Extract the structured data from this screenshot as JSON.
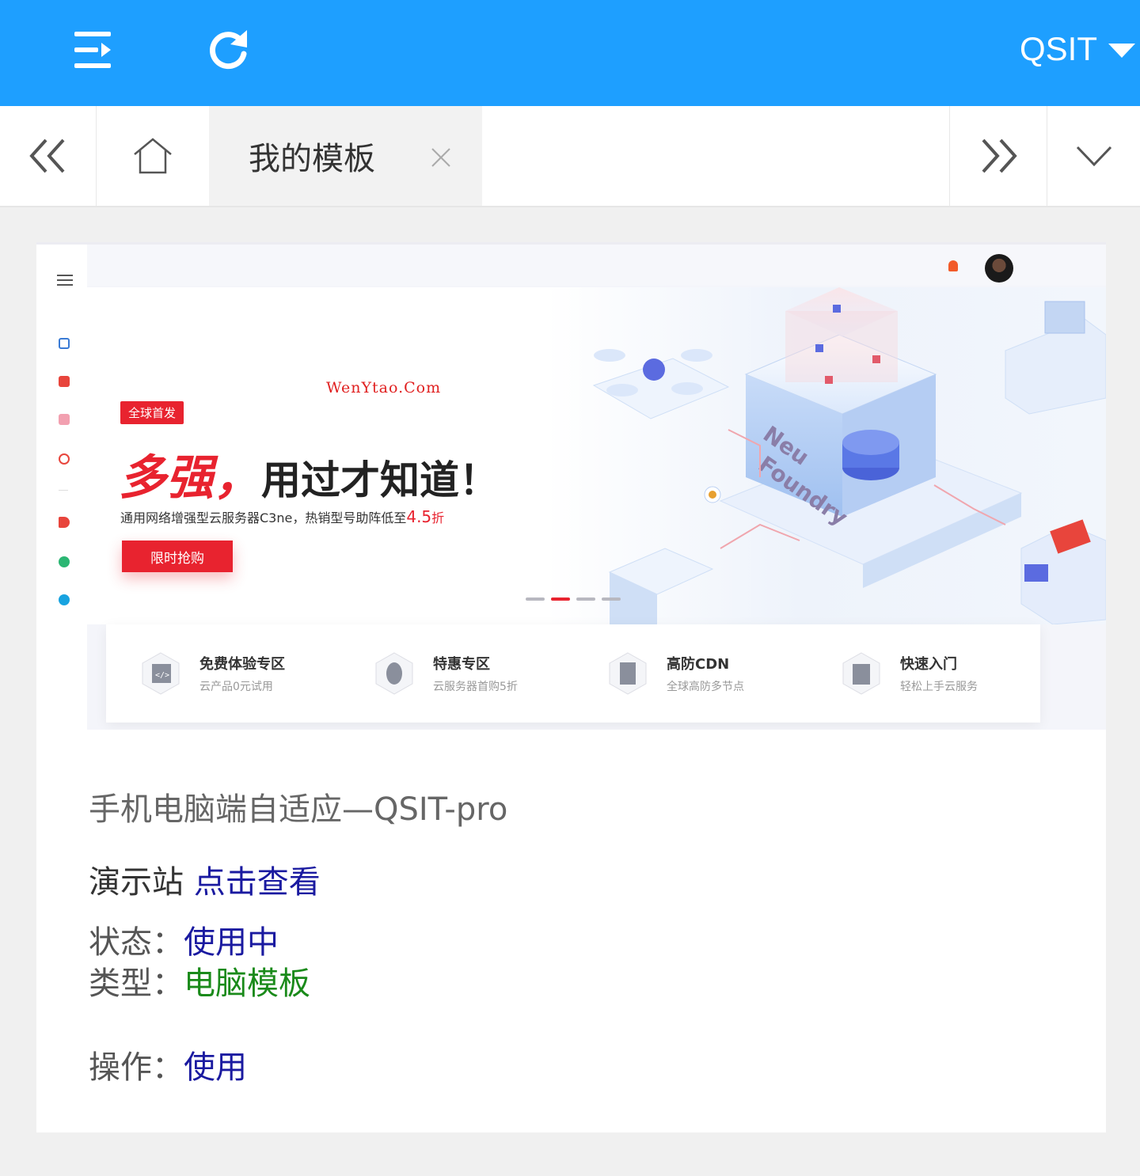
{
  "header": {
    "menu_icon": "indent-menu-icon",
    "refresh_icon": "refresh-icon",
    "user_name": "QSIT",
    "colors": {
      "bar": "#1e9fff"
    }
  },
  "tabs": {
    "prev_icon": "double-chevron-left-icon",
    "home_icon": "home-icon",
    "active_label": "我的模板",
    "close_icon": "close-icon",
    "next_icon": "double-chevron-right-icon",
    "more_icon": "chevron-down-icon"
  },
  "preview": {
    "watermark": "WenYtao.Com",
    "tag": "全球首发",
    "headline_red": "多强，",
    "headline_black": "用过才知道！",
    "sub_text": "通用网络增强型云服务器C3ne，热销型号助阵低至",
    "sub_highlight": "4.5",
    "sub_suffix": "折",
    "button": "限时抢购",
    "features": [
      {
        "title": "免费体验专区",
        "desc": "云产品0元试用"
      },
      {
        "title": "特惠专区",
        "desc": "云服务器首购5折"
      },
      {
        "title": "高防CDN",
        "desc": "全球高防多节点"
      },
      {
        "title": "快速入门",
        "desc": "轻松上手云服务"
      }
    ]
  },
  "template": {
    "title": "手机电脑端自适应—QSIT-pro",
    "demo_label": "演示站",
    "demo_link": "点击查看",
    "status_label": "状态：",
    "status_value": "使用中",
    "type_label": "类型：",
    "type_value": "电脑模板",
    "op_label": "操作：",
    "op_value": "使用",
    "colors": {
      "link": "#1a1aa0",
      "type": "#1a8a1a"
    }
  }
}
